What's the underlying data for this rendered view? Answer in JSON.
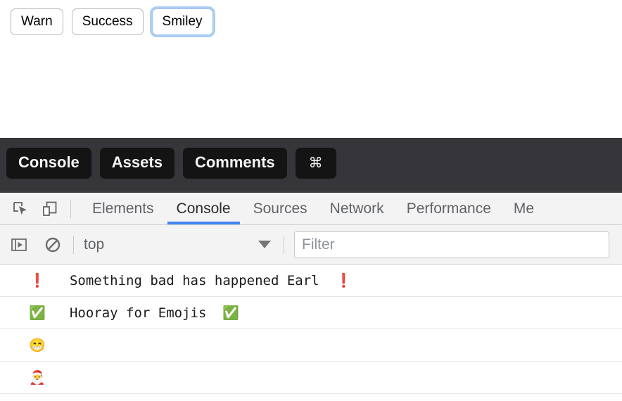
{
  "page": {
    "buttons": [
      {
        "label": "Warn",
        "focused": false
      },
      {
        "label": "Success",
        "focused": false
      },
      {
        "label": "Smiley",
        "focused": true
      }
    ]
  },
  "app_toolbar": {
    "buttons": [
      {
        "label": "Console",
        "icon": ""
      },
      {
        "label": "Assets",
        "icon": ""
      },
      {
        "label": "Comments",
        "icon": ""
      },
      {
        "label": "⌘",
        "icon": "command-icon"
      }
    ]
  },
  "devtools": {
    "icons": {
      "inspect": "inspect-element-icon",
      "device": "device-toolbar-icon",
      "sidebar": "console-sidebar-icon",
      "clear": "clear-console-icon"
    },
    "tabs": [
      {
        "label": "Elements",
        "active": false
      },
      {
        "label": "Console",
        "active": true
      },
      {
        "label": "Sources",
        "active": false
      },
      {
        "label": "Network",
        "active": false
      },
      {
        "label": "Performance",
        "active": false
      },
      {
        "label": "Me",
        "active": false
      }
    ],
    "active_tab_accent": "#4285f4",
    "console_toolbar": {
      "context_value": "top",
      "filter_placeholder": "Filter",
      "filter_value": ""
    },
    "messages": [
      {
        "text": "❗   Something bad has happened Earl  ❗",
        "level": "error"
      },
      {
        "text": "✅   Hooray for Emojis  ✅",
        "level": "log"
      },
      {
        "text": "😁",
        "level": "log"
      },
      {
        "text": "🎅",
        "level": "log"
      }
    ]
  }
}
